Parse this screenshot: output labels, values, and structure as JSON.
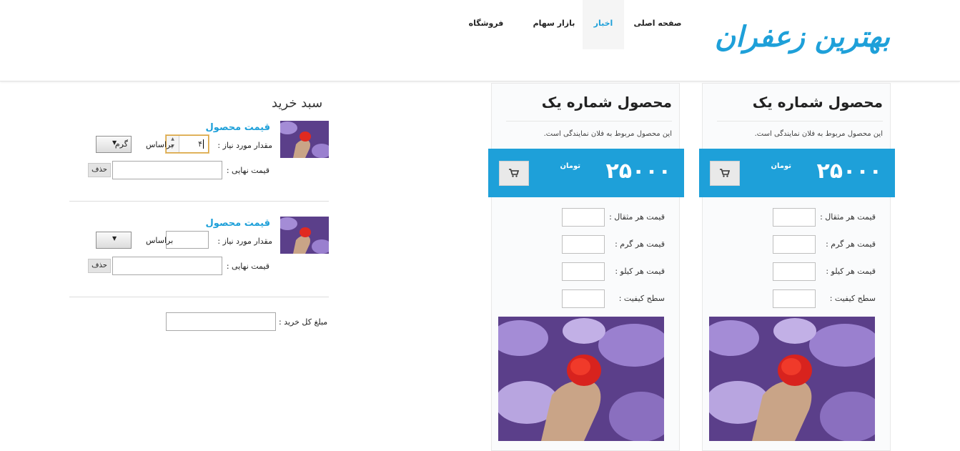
{
  "header": {
    "logo": "بهترین زعفران",
    "nav": [
      "صفحه اصلی",
      "اخبار",
      "بازار سهام",
      "فروشگاه"
    ],
    "active_nav": "اخبار"
  },
  "products": [
    {
      "title": "محصول شماره یک",
      "description": "این محصول مربوط به فلان نمایندگی است.",
      "price": "۲۵۰۰۰",
      "currency": "تومان",
      "fields": [
        "قیمت هر مثقال :",
        "قیمت هر گرم :",
        "قیمت هر کیلو :",
        "سطح کیفیت :"
      ]
    },
    {
      "title": "محصول شماره یک",
      "description": "این محصول مربوط به فلان نمایندگی است.",
      "price": "۲۵۰۰۰",
      "currency": "تومان",
      "fields": [
        "قیمت هر مثقال :",
        "قیمت هر گرم :",
        "قیمت هر کیلو :",
        "سطح کیفیت :"
      ]
    }
  ],
  "cart": {
    "title": "سبد خرید",
    "items": [
      {
        "name": "قیمت محصول",
        "qty_label": "مقدار مورد نیاز :",
        "qty_value": "۴",
        "basis_label": "براساس",
        "unit": "گرم",
        "final_label": "قیمت نهایی :",
        "delete": "حذف"
      },
      {
        "name": "قیمت محصول",
        "qty_label": "مقدار مورد نیاز :",
        "qty_value": "",
        "basis_label": "براساس",
        "unit": "",
        "final_label": "قیمت نهایی :",
        "delete": "حذف"
      }
    ],
    "total_label": "مبلغ کل خرید :"
  },
  "colors": {
    "accent": "#1ea0d9"
  }
}
